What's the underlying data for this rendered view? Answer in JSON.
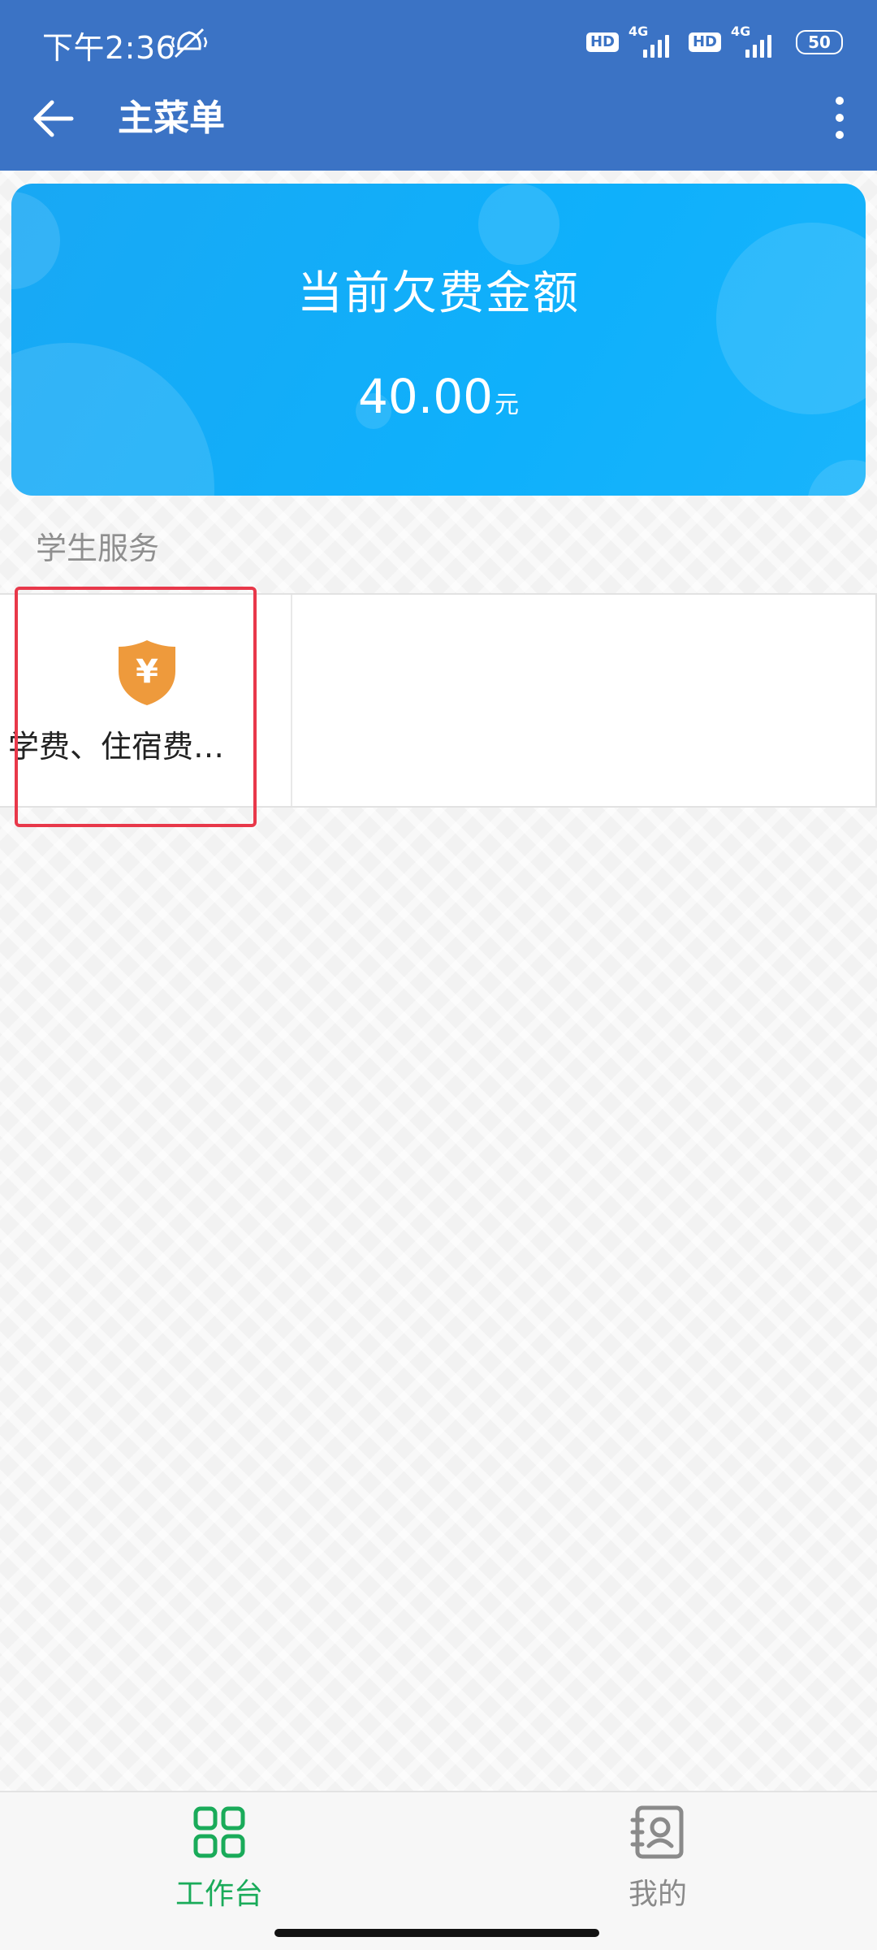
{
  "status_bar": {
    "time": "下午2:36",
    "hd1": "HD",
    "net1": "4G",
    "hd2": "HD",
    "net2": "4G",
    "battery": "50"
  },
  "app_bar": {
    "title": "主菜单"
  },
  "arrears_card": {
    "title": "当前欠费金额",
    "amount": "40.00",
    "unit": "元"
  },
  "section": {
    "title": "学生服务"
  },
  "services": [
    {
      "label": "学费、住宿费…",
      "icon": "yuan-shield-icon"
    }
  ],
  "bottom_nav": {
    "items": [
      {
        "label": "工作台",
        "icon": "grid-icon",
        "active": true
      },
      {
        "label": "我的",
        "icon": "profile-icon",
        "active": false
      }
    ]
  },
  "colors": {
    "app_bar": "#3b73c5",
    "card": "#12aefa",
    "active": "#1aab5a",
    "inactive": "#8a8a8a",
    "highlight": "#e8384a",
    "icon_orange": "#ee9a3c"
  }
}
